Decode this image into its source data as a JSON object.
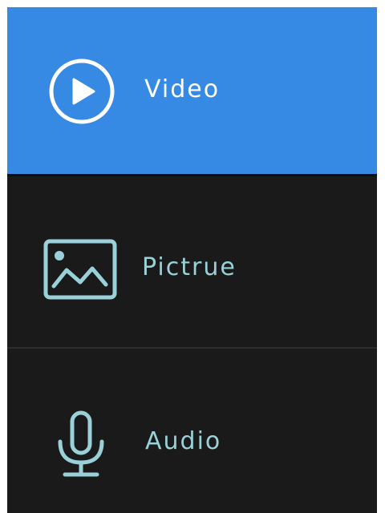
{
  "menu": {
    "items": [
      {
        "label": "Video",
        "icon": "play-circle-icon",
        "active": true
      },
      {
        "label": "Pictrue",
        "icon": "picture-icon",
        "active": false
      },
      {
        "label": "Audio",
        "icon": "microphone-icon",
        "active": false
      }
    ]
  },
  "colors": {
    "active_background": "#368ae3",
    "inactive_background": "#1a1a1a",
    "active_text": "#ffffff",
    "inactive_accent": "#9ad0d8"
  }
}
